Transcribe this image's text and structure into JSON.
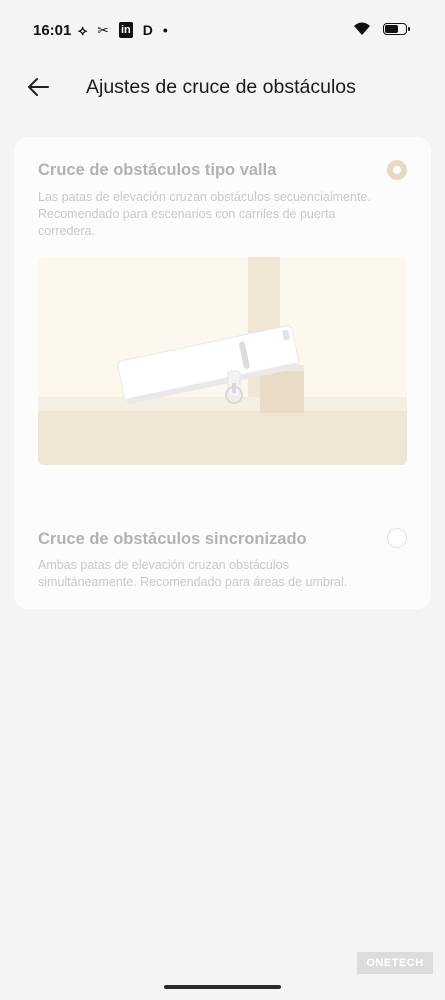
{
  "status_bar": {
    "time": "16:01",
    "app_icons": [
      "link-icon",
      "capcut-icon",
      "linkedin-icon",
      "d-app-icon",
      "notification-dot-icon"
    ],
    "app_icon_glyphs": [
      "⟡",
      "✂",
      "in",
      "D",
      "•"
    ],
    "battery_level": 0.6
  },
  "header": {
    "title": "Ajustes de cruce de obstáculos",
    "back_icon": "arrow-left-icon"
  },
  "options": [
    {
      "title": "Cruce de obstáculos tipo valla",
      "description": "Las patas de elevación cruzan obstáculos secuencialmente. Recomendado para escenarios con carriles de puerta corredera.",
      "selected": true
    },
    {
      "title": "Cruce de obstáculos sincronizado",
      "description": "Ambas patas de elevación cruzan obstáculos simultáneamente. Recomendado para áreas de umbral.",
      "selected": false
    }
  ],
  "watermark": {
    "text": "ONETECH"
  },
  "colors": {
    "accent": "#e7d9c4",
    "illustration_bg": "#fdf8ee",
    "floor": "#eee5d4"
  }
}
